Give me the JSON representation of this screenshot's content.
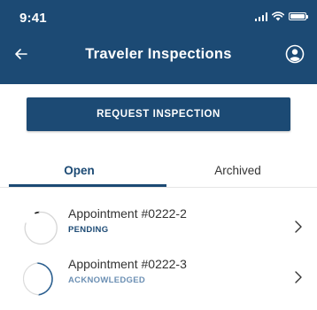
{
  "status_bar": {
    "time": "9:41"
  },
  "header": {
    "title": "Traveler Inspections"
  },
  "request_button": {
    "label": "REQUEST INSPECTION"
  },
  "tabs": [
    {
      "label": "Open",
      "active": true
    },
    {
      "label": "Archived",
      "active": false
    }
  ],
  "appointments": [
    {
      "title": "Appointment #0222-2",
      "status": "PENDING",
      "status_color": "#1c4a74"
    },
    {
      "title": "Appointment #0222-3",
      "status": "ACKNOWLEDGED",
      "status_color": "#6b8fb3"
    }
  ],
  "colors": {
    "primary": "#1c4a74",
    "acknowledged": "#6b8fb3"
  },
  "icons": [
    "back-arrow-icon",
    "profile-icon",
    "signal-icon",
    "wifi-icon",
    "battery-icon",
    "chevron-right-icon"
  ]
}
